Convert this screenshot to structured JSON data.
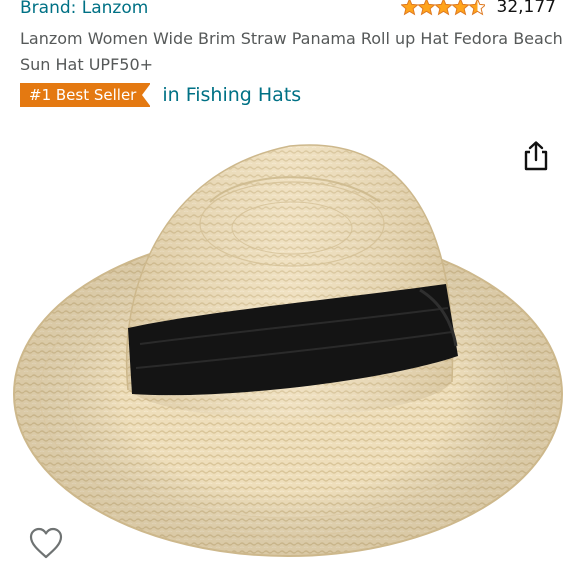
{
  "brand": {
    "label": "Brand: Lanzom"
  },
  "rating": {
    "stars": 4.5,
    "max_stars": 5,
    "star_color": "#ffa41c",
    "count": "32,177"
  },
  "product": {
    "title": "Lanzom Women Wide Brim Straw Panama Roll up Hat Fedora Beach Sun Hat UPF50+",
    "image_icon": "straw-panama-hat-photo"
  },
  "best_seller": {
    "badge": "#1 Best Seller",
    "category": "in Fishing Hats",
    "badge_color": "#e47911"
  },
  "actions": {
    "share_icon": "share-icon",
    "wishlist_icon": "heart-outline-icon"
  },
  "colors": {
    "link": "#007185",
    "text_secondary": "#565959"
  }
}
